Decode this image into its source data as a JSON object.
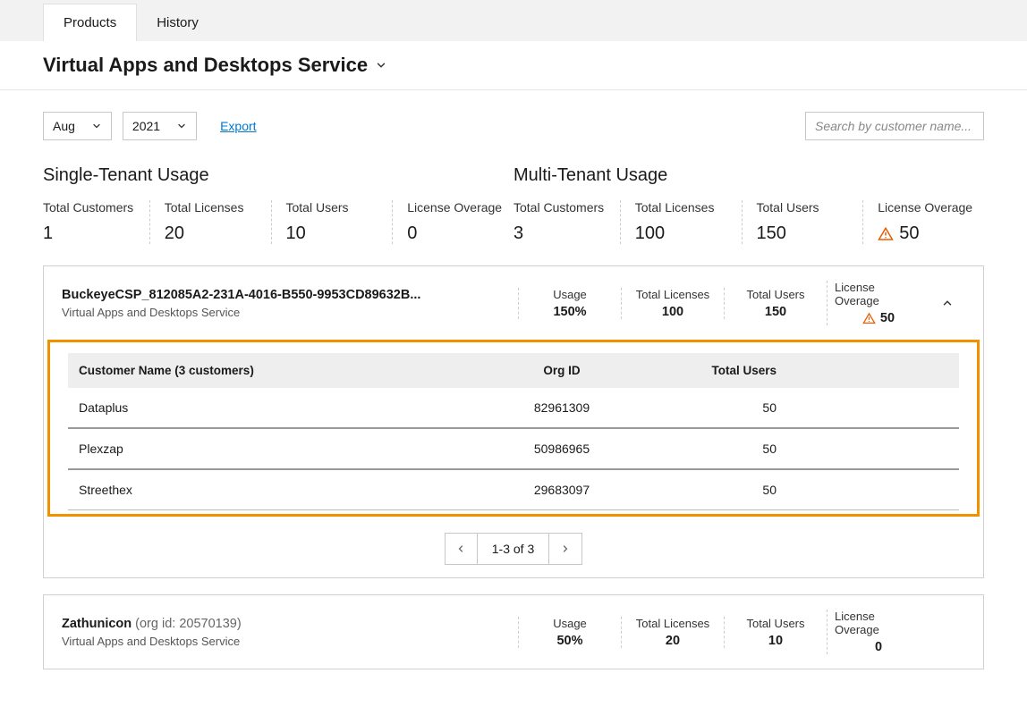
{
  "tabs": {
    "products": "Products",
    "history": "History"
  },
  "page_title": "Virtual Apps and Desktops Service",
  "filters": {
    "month": "Aug",
    "year": "2021",
    "export": "Export"
  },
  "search_placeholder": "Search by customer name...",
  "single_tenant": {
    "heading": "Single-Tenant Usage",
    "labels": {
      "customers": "Total Customers",
      "licenses": "Total Licenses",
      "users": "Total Users",
      "overage": "License Overage"
    },
    "values": {
      "customers": "1",
      "licenses": "20",
      "users": "10",
      "overage": "0"
    }
  },
  "multi_tenant": {
    "heading": "Multi-Tenant Usage",
    "labels": {
      "customers": "Total Customers",
      "licenses": "Total Licenses",
      "users": "Total Users",
      "overage": "License Overage"
    },
    "values": {
      "customers": "3",
      "licenses": "100",
      "users": "150",
      "overage": "50"
    }
  },
  "card_labels": {
    "usage": "Usage",
    "licenses": "Total Licenses",
    "users": "Total Users",
    "overage": "License Overage"
  },
  "card1": {
    "name": "BuckeyeCSP_812085A2-231A-4016-B550-9953CD89632B...",
    "service": "Virtual Apps and Desktops Service",
    "usage": "150%",
    "licenses": "100",
    "users": "150",
    "overage": "50"
  },
  "subtable": {
    "headers": {
      "name": "Customer Name (3 customers)",
      "org": "Org ID",
      "users": "Total Users"
    },
    "rows": [
      {
        "name": "Dataplus",
        "org": "82961309",
        "users": "50"
      },
      {
        "name": "Plexzap",
        "org": "50986965",
        "users": "50"
      },
      {
        "name": "Streethex",
        "org": "29683097",
        "users": "50"
      }
    ]
  },
  "pager": "1-3 of 3",
  "card2": {
    "name": "Zathunicon",
    "org_id": " (org id: 20570139)",
    "service": "Virtual Apps and Desktops Service",
    "usage": "50%",
    "licenses": "20",
    "users": "10",
    "overage": "0"
  }
}
